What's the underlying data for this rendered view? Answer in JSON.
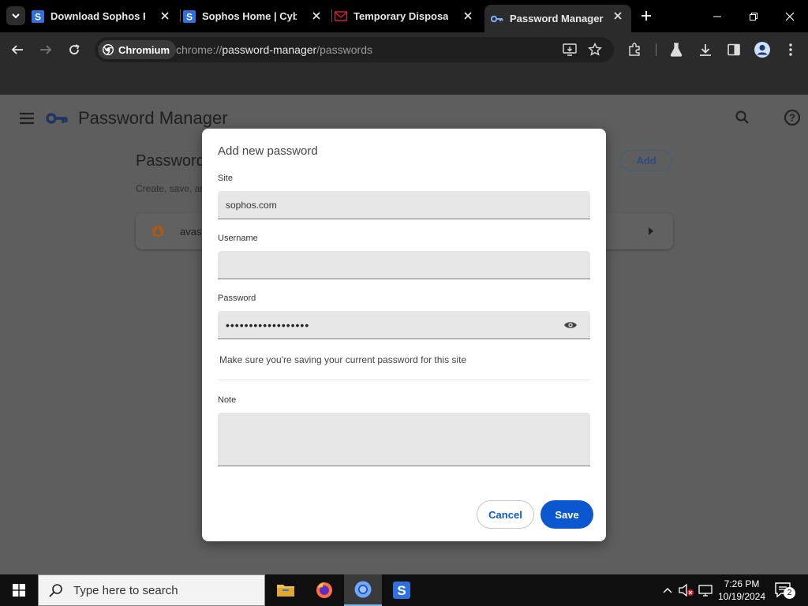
{
  "browser": {
    "tabs": [
      {
        "title": "Download Sophos Fre",
        "icon": "sophos-icon"
      },
      {
        "title": "Sophos Home | Cyber",
        "icon": "sophos-icon"
      },
      {
        "title": "Temporary Disposable",
        "icon": "mail-icon"
      },
      {
        "title": "Password Manager",
        "icon": "key-icon",
        "active": true
      }
    ],
    "omnibox": {
      "chip": "Chromium",
      "url_scheme": "chrome://",
      "url_host": "password-manager",
      "url_path": "/passwords"
    }
  },
  "page": {
    "app_title": "Password Manager",
    "heading": "Passwords",
    "subtitle": "Create, save, ar",
    "add_label": "Add",
    "rows": [
      {
        "label": "avast"
      }
    ]
  },
  "dialog": {
    "title": "Add new password",
    "site_label": "Site",
    "site_value": "sophos.com",
    "username_label": "Username",
    "username_value": "",
    "password_label": "Password",
    "password_masked": "••••••••••••••••••",
    "hint": "Make sure you're saving your current password for this site",
    "note_label": "Note",
    "note_value": "",
    "cancel_label": "Cancel",
    "save_label": "Save"
  },
  "taskbar": {
    "search_placeholder": "Type here to search",
    "time": "7:26 PM",
    "date": "10/19/2024",
    "notification_count": "2"
  },
  "colors": {
    "accent": "#0b57d0",
    "scrim": "#5e5e5e"
  }
}
